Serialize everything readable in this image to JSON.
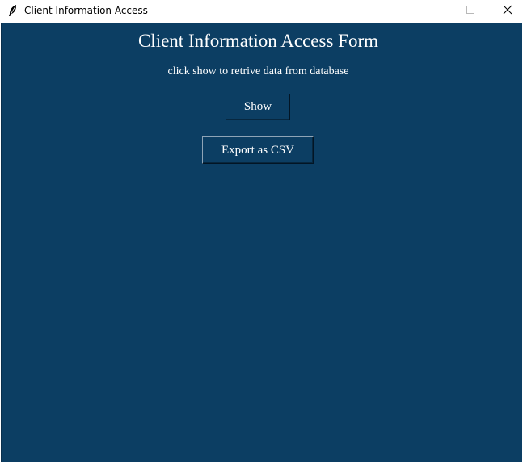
{
  "window": {
    "title": "Client Information Access",
    "icon": "feather-icon",
    "controls": {
      "minimize": "minimize-icon",
      "maximize": "maximize-icon",
      "close": "close-icon"
    }
  },
  "form": {
    "title": "Client Information Access Form",
    "subtitle": "click show to retrive data from database",
    "show_label": "Show",
    "export_label": "Export as CSV"
  },
  "colors": {
    "background": "#0c3e63",
    "text": "#ffffff"
  }
}
